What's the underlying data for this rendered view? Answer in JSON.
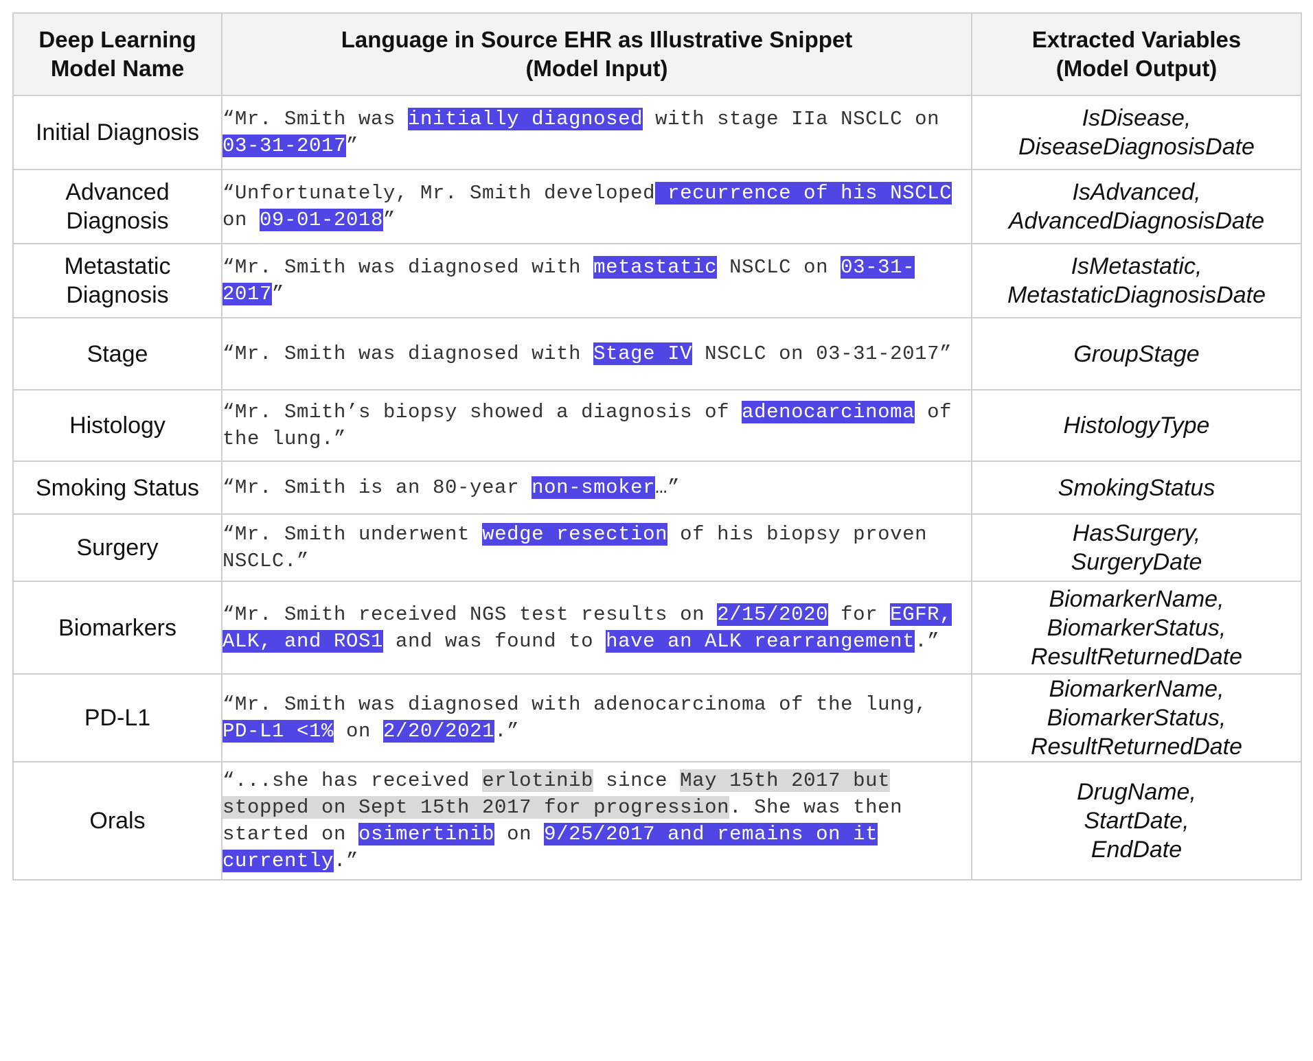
{
  "header": {
    "col_model": [
      "Deep Learning",
      "Model Name"
    ],
    "col_snippet": [
      "Language in Source EHR as Illustrative Snippet",
      "(Model Input)"
    ],
    "col_vars": [
      "Extracted Variables",
      "(Model Output)"
    ]
  },
  "rows": [
    {
      "model": "Initial Diagnosis",
      "snippet": [
        {
          "t": "“Mr. Smith was "
        },
        {
          "t": "initially diagnosed",
          "h": "blue"
        },
        {
          "t": " with stage IIa NSCLC on "
        },
        {
          "t": "03-31-2017",
          "h": "blue"
        },
        {
          "t": "”"
        }
      ],
      "vars": [
        "IsDisease,",
        "DiseaseDiagnosisDate"
      ]
    },
    {
      "model": "Advanced Diagnosis",
      "snippet": [
        {
          "t": "“Unfortunately, Mr. Smith developed"
        },
        {
          "t": " recurrence of his NSCLC",
          "h": "blue"
        },
        {
          "t": " on "
        },
        {
          "t": "09-01-2018",
          "h": "blue"
        },
        {
          "t": "”"
        }
      ],
      "vars": [
        "IsAdvanced,",
        "AdvancedDiagnosisDate"
      ]
    },
    {
      "model": "Metastatic Diagnosis",
      "snippet": [
        {
          "t": "“Mr. Smith was diagnosed with "
        },
        {
          "t": "metastatic",
          "h": "blue"
        },
        {
          "t": " NSCLC on "
        },
        {
          "t": "03-31-2017",
          "h": "blue"
        },
        {
          "t": "”"
        }
      ],
      "vars": [
        "IsMetastatic,",
        "MetastaticDiagnosisDate"
      ]
    },
    {
      "model": "Stage",
      "snippet": [
        {
          "t": "“Mr. Smith was diagnosed with "
        },
        {
          "t": "Stage IV",
          "h": "blue"
        },
        {
          "t": "  NSCLC on 03-31-2017”"
        }
      ],
      "vars": [
        "GroupStage"
      ]
    },
    {
      "model": "Histology",
      "snippet": [
        {
          "t": "“Mr. Smith’s biopsy showed a diagnosis of "
        },
        {
          "t": "adenocarcinoma",
          "h": "blue"
        },
        {
          "t": " of the lung.”"
        }
      ],
      "vars": [
        "HistologyType"
      ]
    },
    {
      "model": "Smoking Status",
      "snippet": [
        {
          "t": "“Mr. Smith is an 80-year "
        },
        {
          "t": "non-smoker",
          "h": "blue"
        },
        {
          "t": "…”"
        }
      ],
      "vars": [
        "SmokingStatus"
      ]
    },
    {
      "model": "Surgery",
      "snippet": [
        {
          "t": "“Mr. Smith underwent "
        },
        {
          "t": "wedge resection",
          "h": "blue"
        },
        {
          "t": " of his biopsy proven NSCLC.”"
        }
      ],
      "vars": [
        "HasSurgery,",
        "SurgeryDate"
      ]
    },
    {
      "model": "Biomarkers",
      "snippet": [
        {
          "t": "“Mr. Smith received NGS test results on "
        },
        {
          "t": "2/15/2020",
          "h": "blue"
        },
        {
          "t": " for "
        },
        {
          "t": "EGFR, ALK, and ROS1",
          "h": "blue"
        },
        {
          "t": " and was found to "
        },
        {
          "t": "have an ALK rearrangement",
          "h": "blue"
        },
        {
          "t": ".”"
        }
      ],
      "vars": [
        "BiomarkerName,",
        "BiomarkerStatus,",
        "ResultReturnedDate"
      ]
    },
    {
      "model": "PD-L1",
      "snippet": [
        {
          "t": "“Mr. Smith was diagnosed with adenocarcinoma of the lung, "
        },
        {
          "t": "PD-L1 <1%",
          "h": "blue"
        },
        {
          "t": " on "
        },
        {
          "t": "2/20/2021",
          "h": "blue"
        },
        {
          "t": ".”"
        }
      ],
      "vars": [
        "BiomarkerName,",
        "BiomarkerStatus,",
        "ResultReturnedDate"
      ]
    },
    {
      "model": "Orals",
      "snippet": [
        {
          "t": "“...she has received "
        },
        {
          "t": "erlotinib",
          "h": "gray"
        },
        {
          "t": " since "
        },
        {
          "t": "May 15th 2017 but stopped on Sept 15th 2017 for progression",
          "h": "gray"
        },
        {
          "t": ". She was then started on "
        },
        {
          "t": "osimertinib",
          "h": "blue"
        },
        {
          "t": " on "
        },
        {
          "t": "9/25/2017 and remains on it currently",
          "h": "blue"
        },
        {
          "t": ".”"
        }
      ],
      "vars": [
        "DrugName,",
        "StartDate,",
        "EndDate"
      ]
    }
  ]
}
